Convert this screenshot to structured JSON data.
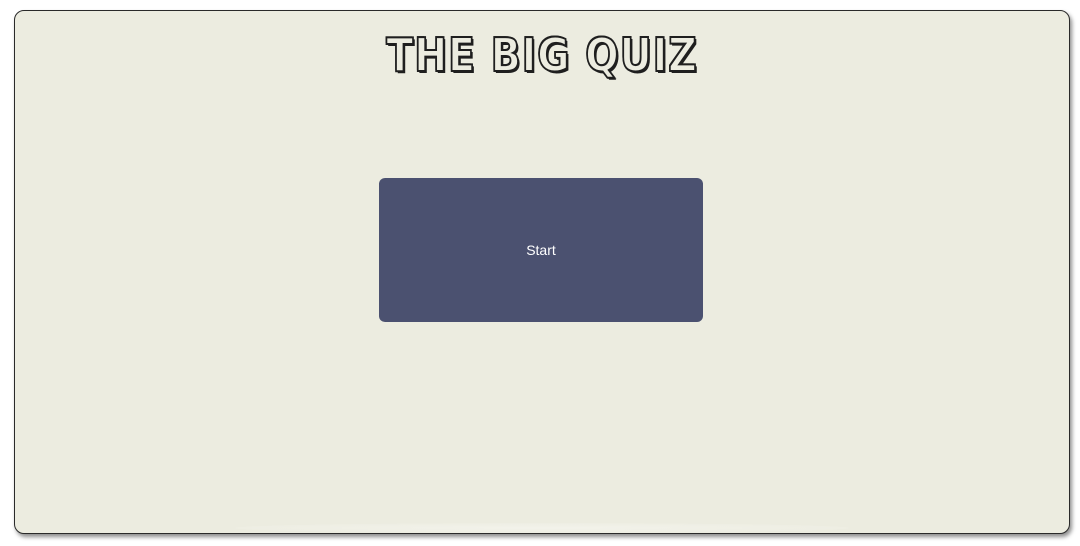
{
  "app": {
    "title": "THE BIG QUIZ"
  },
  "main": {
    "start_label": "Start"
  },
  "colors": {
    "background": "#ecece0",
    "button": "#4b5170",
    "button_text": "#ffffff",
    "title_outline": "#1f1f1f"
  }
}
